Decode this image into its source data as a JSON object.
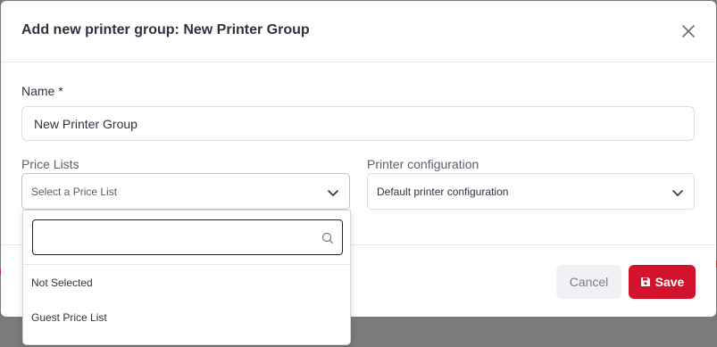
{
  "modal": {
    "title": "Add new printer group: New Printer Group"
  },
  "form": {
    "name_label": "Name *",
    "name_value": "New Printer Group",
    "price_lists_label": "Price Lists",
    "price_lists_placeholder": "Select a Price List",
    "printer_config_label": "Printer configuration",
    "printer_config_value": "Default printer configuration"
  },
  "dropdown": {
    "search_value": "",
    "options": [
      "Not Selected",
      "Guest Price List"
    ]
  },
  "footer": {
    "cancel_label": "Cancel",
    "save_label": "Save"
  },
  "icons": {
    "close": "close-icon",
    "chevron": "chevron-down-icon",
    "search": "search-icon",
    "save": "floppy-disk-icon"
  },
  "colors": {
    "primary": "#d3132b",
    "text": "#2f3240",
    "muted": "#5c5f6b"
  }
}
